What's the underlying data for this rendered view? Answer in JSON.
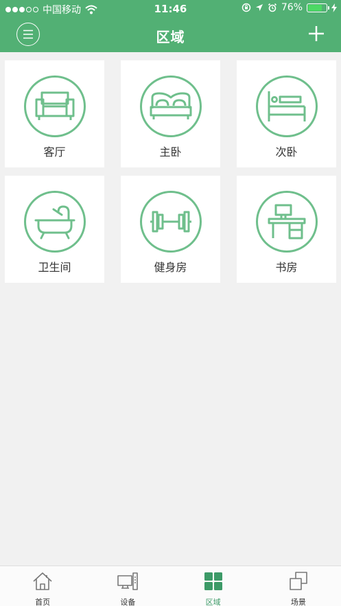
{
  "status_bar": {
    "carrier": "中国移动",
    "time": "11:46",
    "battery": "76%",
    "battery_level": 0.76
  },
  "header": {
    "title": "区域"
  },
  "rooms": [
    {
      "label": "客厅",
      "icon": "sofa-icon"
    },
    {
      "label": "主卧",
      "icon": "double-bed-icon"
    },
    {
      "label": "次卧",
      "icon": "single-bed-icon"
    },
    {
      "label": "卫生间",
      "icon": "bathtub-icon"
    },
    {
      "label": "健身房",
      "icon": "dumbbell-icon"
    },
    {
      "label": "书房",
      "icon": "desk-icon"
    }
  ],
  "tabs": [
    {
      "label": "首页",
      "icon": "home-icon"
    },
    {
      "label": "设备",
      "icon": "device-icon"
    },
    {
      "label": "区域",
      "icon": "grid-icon",
      "active": true
    },
    {
      "label": "场景",
      "icon": "scene-icon"
    }
  ],
  "colors": {
    "accent": "#52b074",
    "icon_green": "#6fbf8c",
    "active_tab": "#3c9a67"
  }
}
